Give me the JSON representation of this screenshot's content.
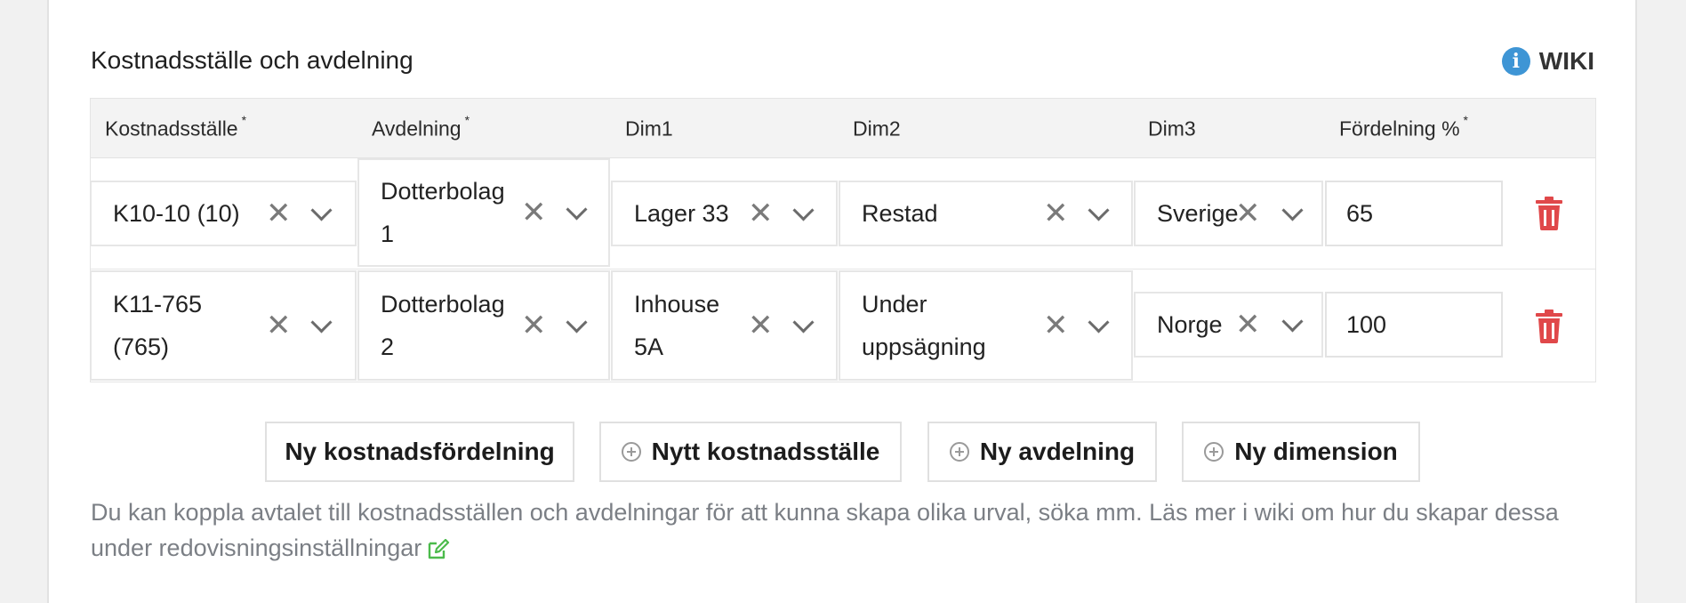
{
  "section": {
    "title": "Kostnadsställe och avdelning",
    "wiki_label": "WIKI",
    "info_glyph": "i"
  },
  "table": {
    "headers": [
      {
        "label": "Kostnadsställe",
        "required": "*"
      },
      {
        "label": "Avdelning",
        "required": "*"
      },
      {
        "label": "Dim1",
        "required": ""
      },
      {
        "label": "Dim2",
        "required": ""
      },
      {
        "label": "Dim3",
        "required": ""
      },
      {
        "label": "Fördelning %",
        "required": "*"
      }
    ],
    "rows": [
      {
        "kostnadsstalle": [
          "K10-10 (10)"
        ],
        "avdelning": [
          "Dotterbolag",
          "1"
        ],
        "dim1": [
          "Lager 33"
        ],
        "dim2": [
          "Restad"
        ],
        "dim3": [
          "Sverige"
        ],
        "fordelning": "65"
      },
      {
        "kostnadsstalle": [
          "K11-765",
          "(765)"
        ],
        "avdelning": [
          "Dotterbolag",
          "2"
        ],
        "dim1": [
          "Inhouse",
          "5A"
        ],
        "dim2": [
          "Under",
          "uppsägning"
        ],
        "dim3": [
          "Norge"
        ],
        "fordelning": "100"
      }
    ],
    "icons": {
      "clear": "close-icon",
      "dropdown": "chevron-down-icon",
      "delete": "trash-icon"
    },
    "clear_glyph": "✕"
  },
  "buttons": {
    "new_distribution": "Ny kostnadsfördelning",
    "new_cost_center": "Nytt kostnadsställe",
    "new_department": "Ny avdelning",
    "new_dimension": "Ny dimension"
  },
  "help": {
    "text": "Du kan koppla avtalet till kostnadsställen och avdelningar för att kunna skapa olika urval, söka mm. Läs mer i wiki om hur du skapar dessa under redovisningsinställningar"
  },
  "colors": {
    "accent_info": "#3e95d5",
    "delete": "#e0484a",
    "edit_link": "#4cbb4c",
    "help_text": "#7b7f85"
  }
}
